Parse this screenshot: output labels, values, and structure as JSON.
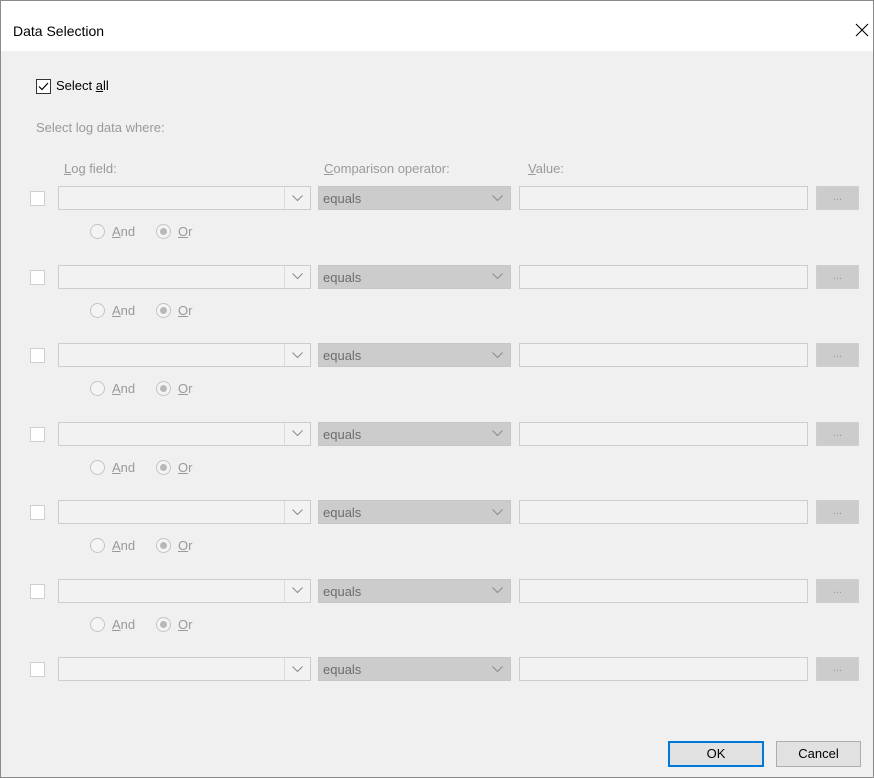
{
  "window": {
    "title": "Data Selection"
  },
  "select_all": {
    "label_prefix": "Select ",
    "label_accel": "a",
    "label_suffix": "ll",
    "checked": true
  },
  "hint_text": "Select log data where:",
  "columns": {
    "log_field": {
      "accel": "L",
      "rest": "og field:"
    },
    "comparison": {
      "accel": "C",
      "rest": "omparison operator:"
    },
    "value": {
      "accel": "V",
      "rest": "alue:"
    }
  },
  "rows": [
    {
      "operator": "equals",
      "browse": "...",
      "and_accel": "A",
      "and_rest": "nd",
      "or_accel": "O",
      "or_rest": "r",
      "selected": "or"
    },
    {
      "operator": "equals",
      "browse": "...",
      "and_accel": "A",
      "and_rest": "nd",
      "or_accel": "O",
      "or_rest": "r",
      "selected": "or"
    },
    {
      "operator": "equals",
      "browse": "...",
      "and_accel": "A",
      "and_rest": "nd",
      "or_accel": "O",
      "or_rest": "r",
      "selected": "or"
    },
    {
      "operator": "equals",
      "browse": "...",
      "and_accel": "A",
      "and_rest": "nd",
      "or_accel": "O",
      "or_rest": "r",
      "selected": "or"
    },
    {
      "operator": "equals",
      "browse": "...",
      "and_accel": "A",
      "and_rest": "nd",
      "or_accel": "O",
      "or_rest": "r",
      "selected": "or"
    },
    {
      "operator": "equals",
      "browse": "...",
      "and_accel": "A",
      "and_rest": "nd",
      "or_accel": "O",
      "or_rest": "r",
      "selected": "or"
    },
    {
      "operator": "equals",
      "browse": "..."
    }
  ],
  "buttons": {
    "ok": "OK",
    "cancel": "Cancel"
  },
  "icons": {
    "close": "close-icon",
    "dropdown": "chevron-down-icon",
    "check": "checkmark-icon"
  },
  "colors": {
    "accent": "#0078d7",
    "disabled_text": "#9a9a9a"
  }
}
